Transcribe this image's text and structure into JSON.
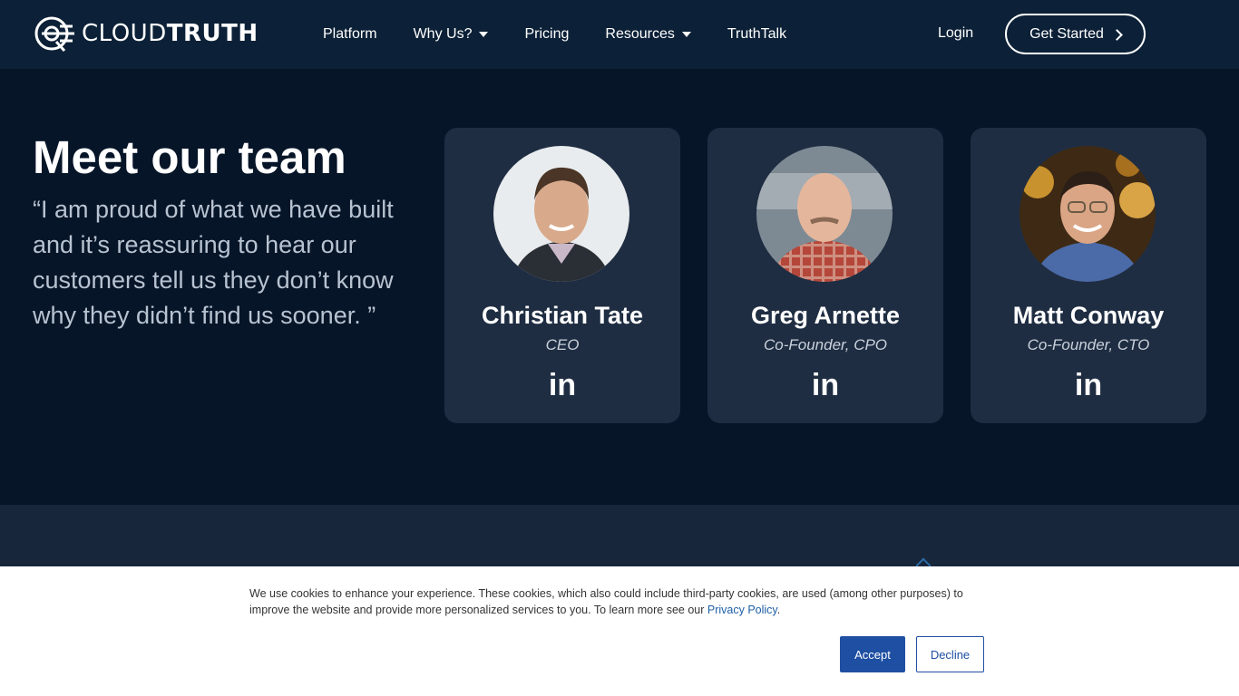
{
  "header": {
    "logo": {
      "light": "CLOUD",
      "bold": "TRUTH",
      "icon": "cloudtruth-logo-icon"
    },
    "nav": [
      {
        "label": "Platform",
        "dropdown": false
      },
      {
        "label": "Why Us?",
        "dropdown": true
      },
      {
        "label": "Pricing",
        "dropdown": false
      },
      {
        "label": "Resources",
        "dropdown": true
      },
      {
        "label": "TruthTalk",
        "dropdown": false
      }
    ],
    "login_label": "Login",
    "cta_label": "Get Started"
  },
  "team": {
    "title": "Meet our team",
    "quote": "“I am proud of what we have built and it’s reassuring to hear our customers tell us they don’t know why they didn’t find us sooner. ”",
    "members": [
      {
        "name": "Christian Tate",
        "role": "CEO",
        "link_icon": "linkedin-icon",
        "link_text": "in"
      },
      {
        "name": "Greg Arnette",
        "role": "Co-Founder, CPO",
        "link_icon": "linkedin-icon",
        "link_text": "in"
      },
      {
        "name": "Matt Conway",
        "role": "Co-Founder, CTO",
        "link_icon": "linkedin-icon",
        "link_text": "in"
      }
    ]
  },
  "cookie": {
    "text": "We use cookies to enhance your experience. These cookies, which also could include third-party cookies, are used (among other purposes) to improve the website and provide more personalized services to you. To learn more see our ",
    "link_label": "Privacy Policy",
    "after_link": ".",
    "accept_label": "Accept",
    "decline_label": "Decline"
  },
  "colors": {
    "header_bg": "#0c2137",
    "section_bg": "#061528",
    "card_bg": "#1f2d42",
    "accept_bg": "#1f4fa2"
  }
}
